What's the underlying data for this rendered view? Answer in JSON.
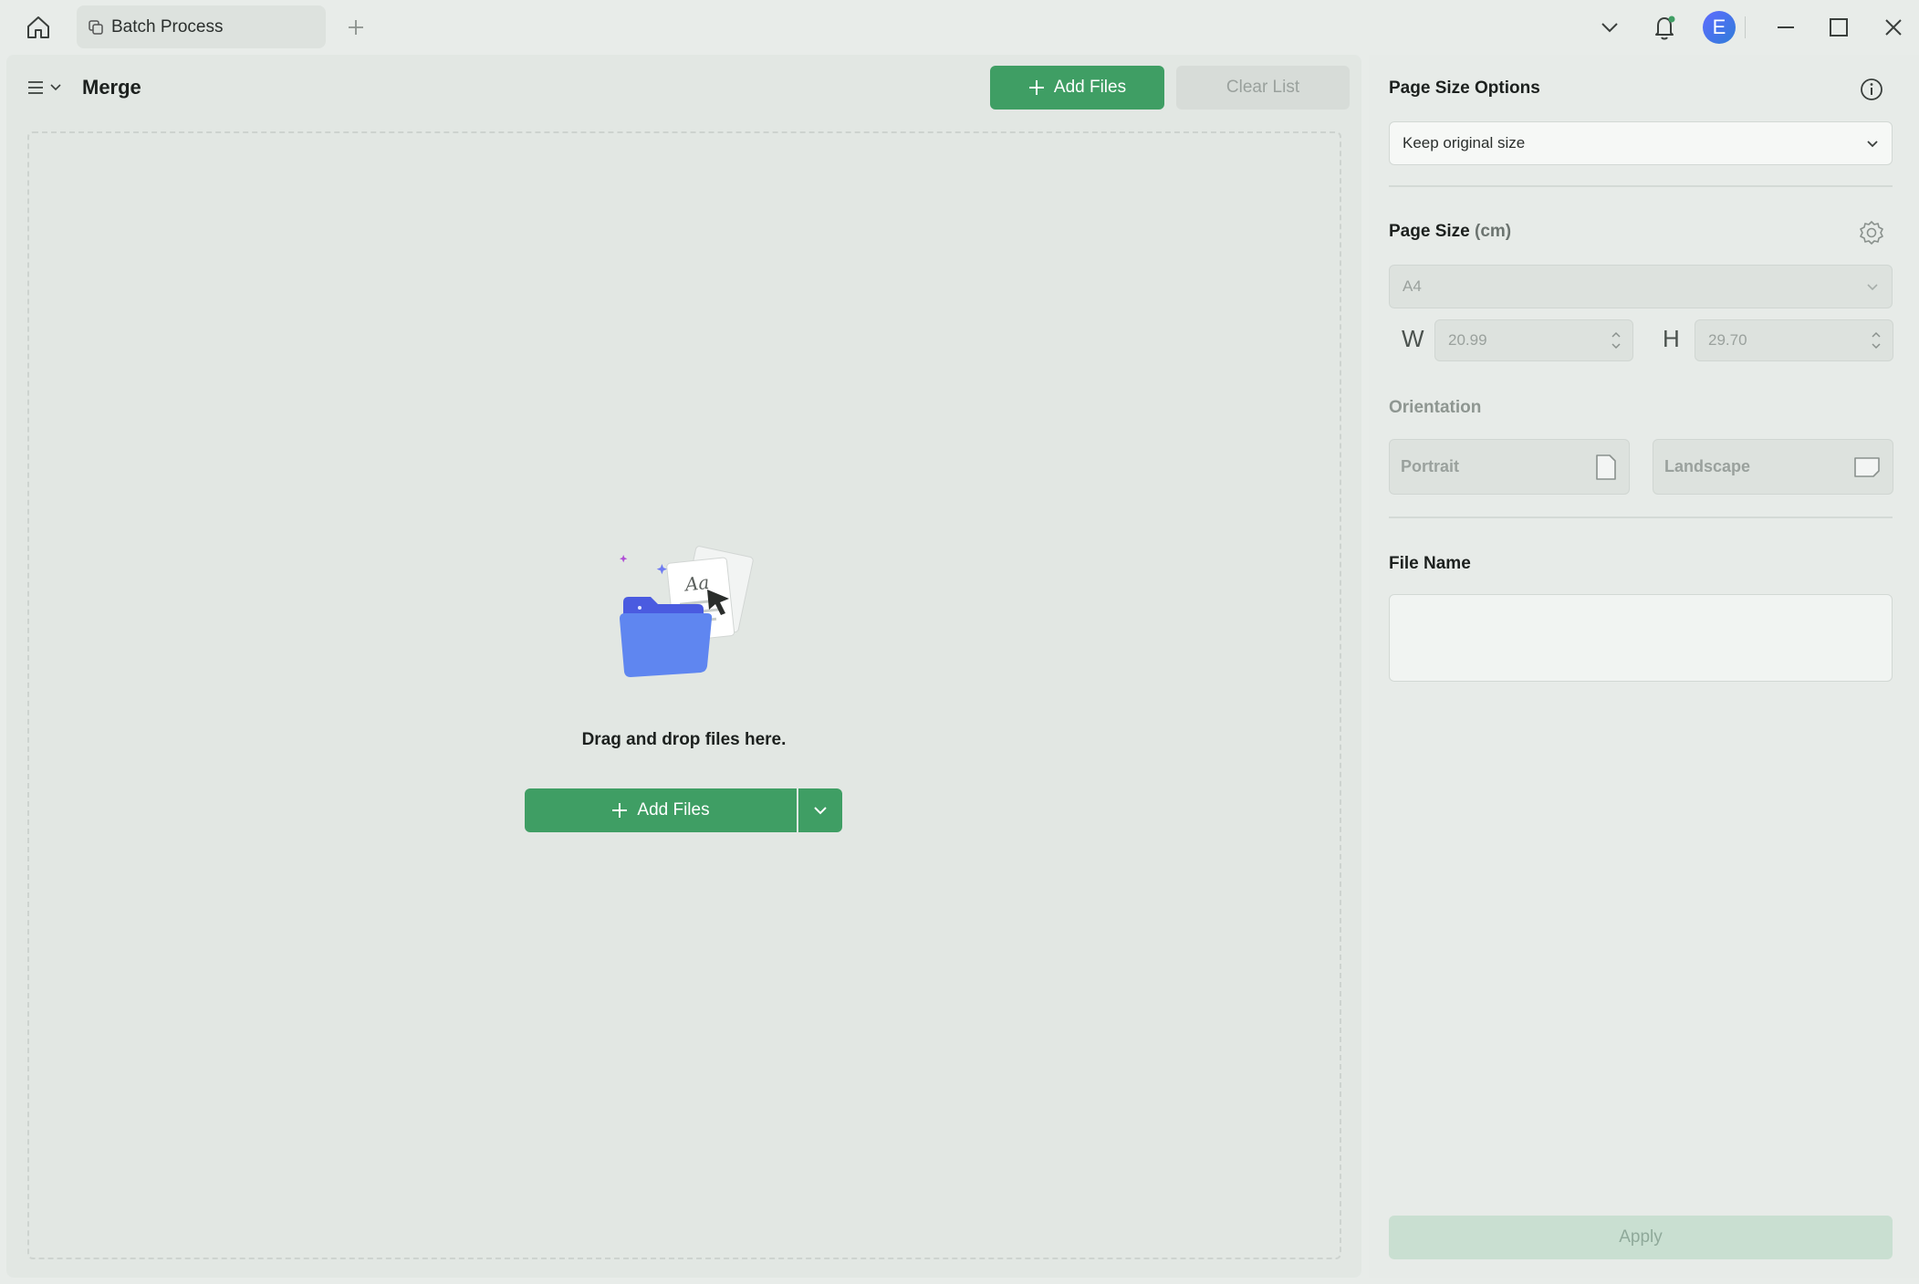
{
  "tabs": [
    {
      "label": "Batch Process"
    }
  ],
  "user": {
    "initial": "E",
    "avatar_color": "#4a6bef"
  },
  "toolbar": {
    "title": "Merge",
    "add_files_label": "Add Files",
    "clear_list_label": "Clear List"
  },
  "dropzone": {
    "message": "Drag and drop files here.",
    "add_files_label": "Add Files"
  },
  "settings": {
    "page_size_options": {
      "title": "Page Size Options",
      "selected": "Keep original size"
    },
    "page_size": {
      "title": "Page Size",
      "unit": "(cm)",
      "preset": "A4",
      "width_label": "W",
      "width_value": "20.99",
      "height_label": "H",
      "height_value": "29.70"
    },
    "orientation": {
      "title": "Orientation",
      "portrait_label": "Portrait",
      "landscape_label": "Landscape"
    },
    "file_name": {
      "title": "File Name",
      "value": ""
    },
    "apply_label": "Apply"
  },
  "colors": {
    "accent_green": "#3f9e64",
    "disabled_green": "#c9dfd1",
    "background": "#e8ece9"
  }
}
